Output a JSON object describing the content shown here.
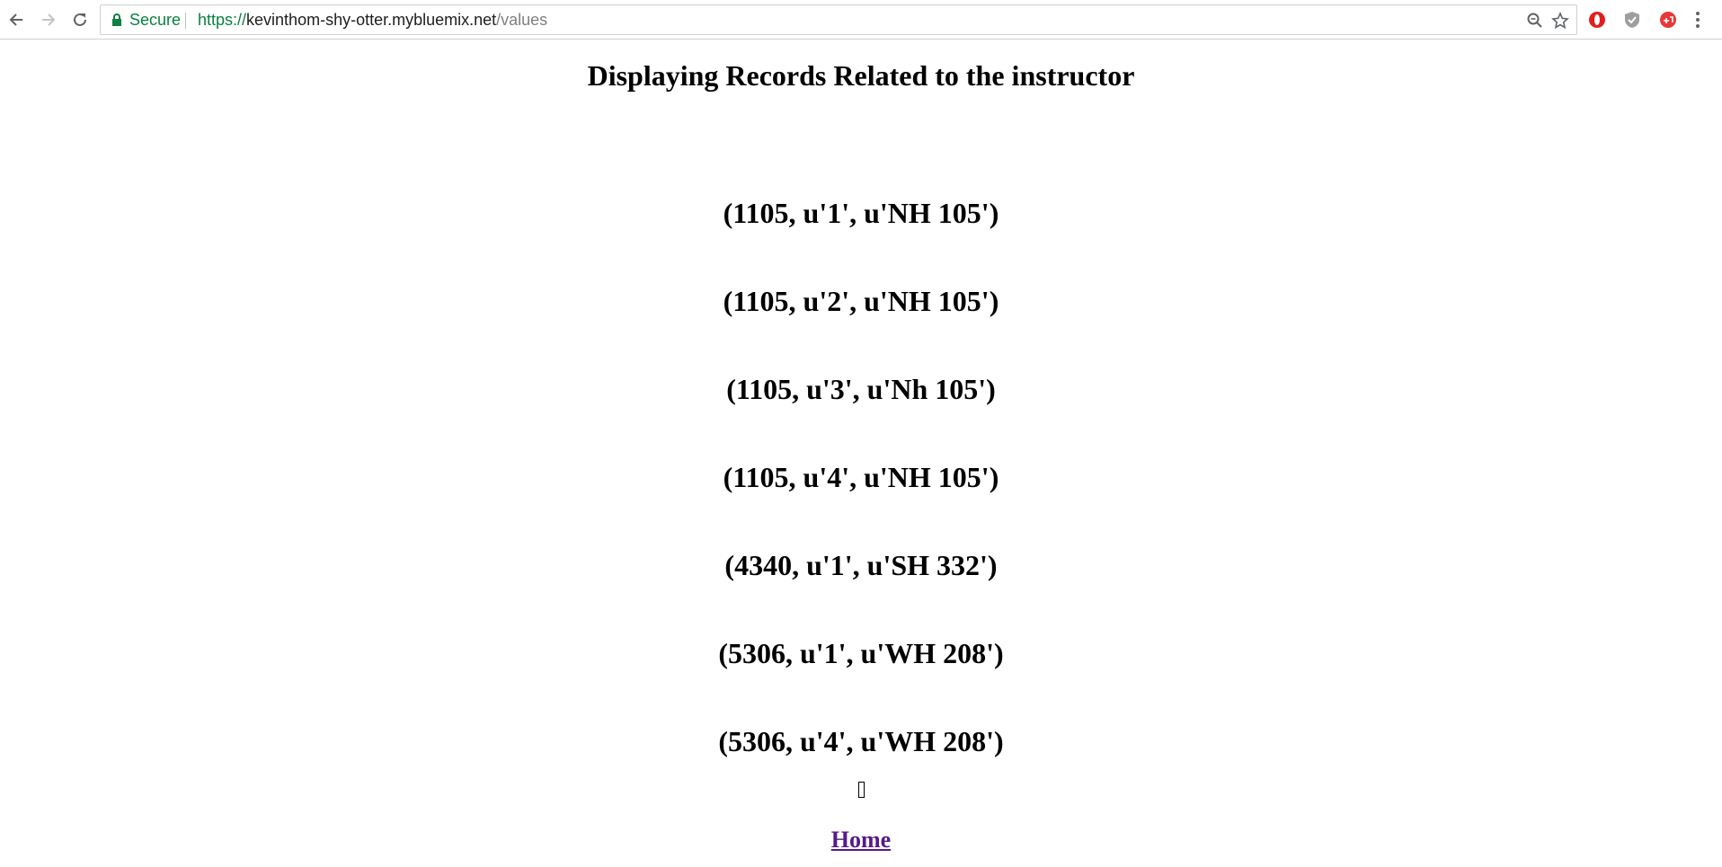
{
  "browser": {
    "secure_label": "Secure",
    "url": {
      "scheme": "https://",
      "host": "kevinthom-shy-otter.mybluemix.net",
      "path": "/values"
    },
    "icons": [
      "back-arrow-icon",
      "forward-arrow-icon",
      "reload-icon",
      "lock-icon",
      "zoom-icon",
      "bookmark-star-icon",
      "opera-extension-icon",
      "shield-extension-icon",
      "red-extension-icon",
      "menu-dots-icon"
    ]
  },
  "page": {
    "title": "Displaying Records Related to the instructor",
    "records": [
      "(1105, u'1', u'NH 105')",
      "(1105, u'2', u'NH 105')",
      "(1105, u'3', u'Nh 105')",
      "(1105, u'4', u'NH 105')",
      "(4340, u'1', u'SH 332')",
      "(5306, u'1', u'WH 208')",
      "(5306, u'4', u'WH 208')"
    ],
    "home_link": "Home"
  },
  "colors": {
    "secure_green": "#0b8043",
    "link_visited": "#551a8b",
    "text": "#000000"
  }
}
